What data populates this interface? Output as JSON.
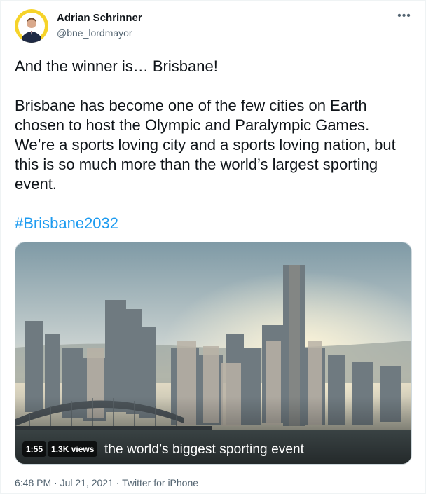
{
  "author": {
    "name": "Adrian Schrinner",
    "handle": "@bne_lordmayor",
    "avatar_icon": "profile-photo-icon"
  },
  "more_icon": "more-options-icon",
  "tweet": {
    "paragraph1": "And the winner is… Brisbane!",
    "paragraph2": "Brisbane has become one of the few cities on Earth chosen to host the Olympic and Paralympic Games. We’re a sports loving city and a sports loving nation, but this is so much more than the world’s largest sporting event.",
    "hashtag": "#Brisbane2032"
  },
  "video": {
    "duration": "1:55",
    "views": "1.3K views",
    "caption": "the world’s biggest sporting event"
  },
  "meta": {
    "time": "6:48 PM",
    "separator": " · ",
    "date": "Jul 21, 2021",
    "source": "Twitter for iPhone"
  },
  "colors": {
    "link": "#1d9bf0",
    "secondary_text": "#536471",
    "primary_text": "#0f1419"
  }
}
